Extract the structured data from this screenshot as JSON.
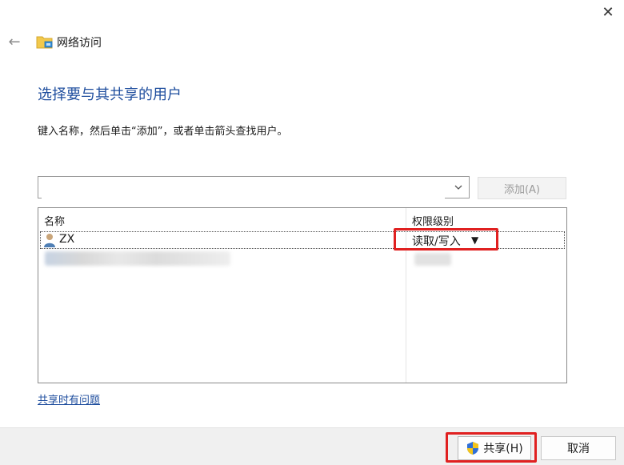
{
  "window": {
    "close_glyph": "✕"
  },
  "nav": {
    "back_glyph": "←",
    "title": "网络访问",
    "title_icon": "network-folder-icon"
  },
  "main": {
    "heading": "选择要与其共享的用户",
    "instruction": "键入名称，然后单击“添加”，或者单击箭头查找用户。"
  },
  "combo": {
    "value": "",
    "placeholder": ""
  },
  "add_button": {
    "label": "添加(A)"
  },
  "table": {
    "columns": [
      "名称",
      "权限级别"
    ],
    "rows": [
      {
        "name": "ZX",
        "permission": "读取/写入",
        "selected": true
      }
    ]
  },
  "link": {
    "trouble": "共享时有问题"
  },
  "footer": {
    "share_label": "共享(H)",
    "cancel_label": "取消"
  },
  "colors": {
    "heading": "#1f4e9e",
    "highlight": "#e02020",
    "footer_bg": "#f0f0f0"
  }
}
